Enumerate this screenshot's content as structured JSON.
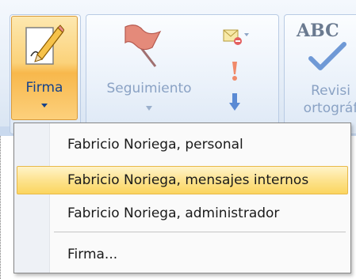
{
  "ribbon": {
    "firma_label": "Firma",
    "seguimiento_label": "Seguimiento",
    "revision_text_abc": "ABC",
    "revision_line1": "Revisi",
    "revision_line2": "ortográf"
  },
  "menu": {
    "items": [
      {
        "label": "Fabricio Noriega, personal",
        "highlighted": false
      },
      {
        "label": "Fabricio Noriega, mensajes internos",
        "highlighted": true
      },
      {
        "label": "Fabricio Noriega, administrador",
        "highlighted": false
      },
      {
        "label": "Firma...",
        "highlighted": false
      }
    ]
  },
  "colors": {
    "highlight": "#fbd55f",
    "ribbon_text": "#15428b",
    "disabled_text": "#8aa2c4"
  }
}
